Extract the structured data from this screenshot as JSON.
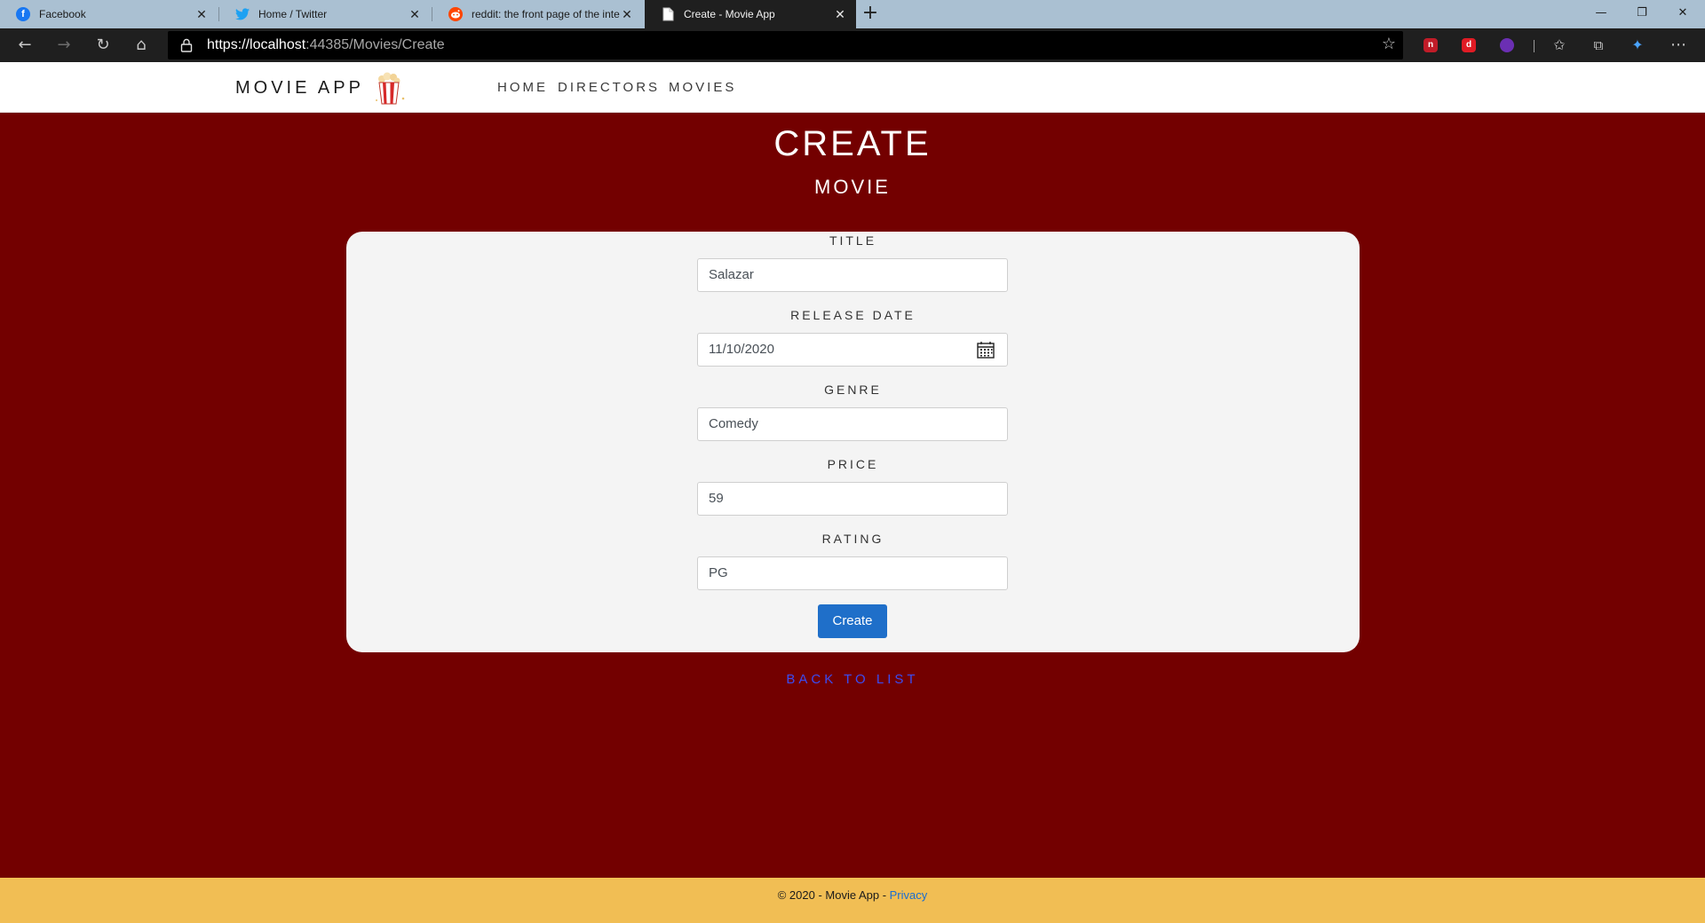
{
  "browser": {
    "tabs": [
      {
        "title": "Facebook",
        "icon": "facebook-icon",
        "color": "#1877f2"
      },
      {
        "title": "Home / Twitter",
        "icon": "twitter-icon",
        "color": "#1da1f2"
      },
      {
        "title": "reddit: the front page of the internet",
        "icon": "reddit-icon",
        "color": "#ff4500"
      },
      {
        "title": "Create - Movie App",
        "icon": "page-icon",
        "color": "#ffffff"
      }
    ],
    "url_host": "https://localhost",
    "url_rest": ":44385/Movies/Create",
    "extensions": [
      {
        "letter": "n",
        "color": "#c01c28"
      },
      {
        "letter": "d",
        "color": "#e01b24"
      }
    ]
  },
  "site": {
    "brand": "MOVIE APP",
    "nav": [
      "HOME",
      "DIRECTORS",
      "MOVIES"
    ]
  },
  "page": {
    "title": "CREATE",
    "subtitle": "MOVIE"
  },
  "form": {
    "fields": [
      {
        "label": "TITLE",
        "value": "Salazar"
      },
      {
        "label": "RELEASE DATE",
        "value": "11/10/2020"
      },
      {
        "label": "GENRE",
        "value": "Comedy"
      },
      {
        "label": "PRICE",
        "value": "59"
      },
      {
        "label": "RATING",
        "value": "PG"
      }
    ],
    "submit_label": "Create"
  },
  "back_link": "BACK TO LIST",
  "footer": {
    "text": "© 2020 - Movie App - ",
    "link": "Privacy"
  },
  "colors": {
    "page_bg": "#730000",
    "footer_bg": "#f1be54",
    "button": "#1f6fc9",
    "link": "#3b4cf2"
  }
}
